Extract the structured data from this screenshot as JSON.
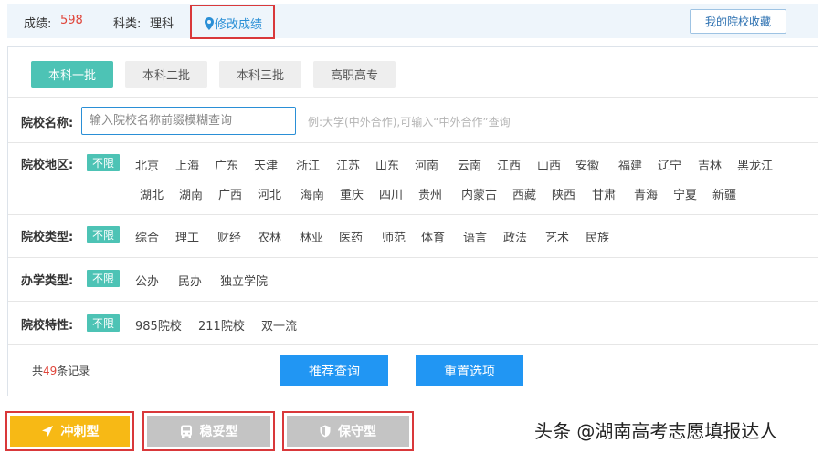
{
  "header": {
    "score_label": "成绩:",
    "score_value": "598",
    "subject_label": "科类:",
    "subject_value": "理科",
    "modify_link": "修改成绩",
    "favorites_button": "我的院校收藏"
  },
  "batch_tabs": [
    "本科一批",
    "本科二批",
    "本科三批",
    "高职高专"
  ],
  "active_batch": "本科一批",
  "search": {
    "label": "院校名称:",
    "placeholder": "输入院校名称前缀模糊查询",
    "hint": "例:大学(中外合作),可输入“中外合作”查询"
  },
  "filters": {
    "region": {
      "label": "院校地区:",
      "selected": "不限",
      "row1": [
        "北京",
        "上海",
        "广东",
        "天津",
        "浙江",
        "江苏",
        "山东",
        "河南",
        "云南",
        "江西",
        "山西",
        "安徽",
        "福建",
        "辽宁",
        "吉林",
        "黑龙江"
      ],
      "row2": [
        "湖北",
        "湖南",
        "广西",
        "河北",
        "海南",
        "重庆",
        "四川",
        "贵州",
        "内蒙古",
        "西藏",
        "陕西",
        "甘肃",
        "青海",
        "宁夏",
        "新疆"
      ]
    },
    "school_type": {
      "label": "院校类型:",
      "selected": "不限",
      "options": [
        "综合",
        "理工",
        "财经",
        "农林",
        "林业",
        "医药",
        "师范",
        "体育",
        "语言",
        "政法",
        "艺术",
        "民族"
      ]
    },
    "ownership": {
      "label": "办学类型:",
      "selected": "不限",
      "options": [
        "公办",
        "民办",
        "独立学院"
      ]
    },
    "features": {
      "label": "院校特性:",
      "selected": "不限",
      "options": [
        "985院校",
        "211院校",
        "双一流"
      ]
    }
  },
  "records": {
    "prefix": "共",
    "count": "49",
    "suffix": "条记录"
  },
  "actions": {
    "search_button": "推荐查询",
    "reset_button": "重置选项"
  },
  "strategy_tabs": [
    {
      "label": "冲刺型",
      "icon": "rocket-icon",
      "color": "#f7b915"
    },
    {
      "label": "稳妥型",
      "icon": "bus-icon",
      "color": "#c4c4c4"
    },
    {
      "label": "保守型",
      "icon": "shield-icon",
      "color": "#c4c4c4"
    }
  ],
  "watermark": "头条 @湖南高考志愿填报达人",
  "colors": {
    "accent_teal": "#4dc3b5",
    "primary_blue": "#2196f3",
    "highlight_red": "#d9383a",
    "score_red": "#e0453a"
  }
}
